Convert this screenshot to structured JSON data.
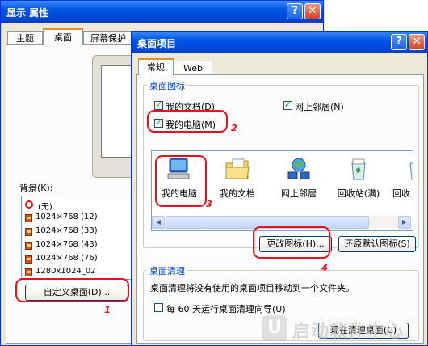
{
  "display_window": {
    "title": "显示 属性",
    "tabs": [
      "主题",
      "桌面",
      "屏幕保护"
    ],
    "background_label": "背景(K):",
    "background_items": [
      "(无)",
      "1024×768  (12)",
      "1024×768  (33)",
      "1024×768  (43)",
      "1024×768  (76)",
      "1280x1024_02"
    ],
    "customize_button": "自定义桌面(D)...",
    "help_btn": "?",
    "close_btn": "✕"
  },
  "desktop_items_window": {
    "title": "桌面项目",
    "help_btn": "?",
    "close_btn": "✕",
    "tabs": [
      "常规",
      "Web"
    ],
    "desktop_icons_group": "桌面图标",
    "checkboxes": [
      {
        "label": "我的文档(D)",
        "checked": true
      },
      {
        "label": "网上邻居(N)",
        "checked": true
      },
      {
        "label": "我的电脑(M)",
        "checked": true
      }
    ],
    "icons": [
      {
        "label": "我的电脑",
        "icon": "my-computer-icon"
      },
      {
        "label": "我的文档",
        "icon": "my-documents-icon"
      },
      {
        "label": "网上邻居",
        "icon": "network-places-icon"
      },
      {
        "label": "回收站(满)",
        "icon": "recycle-bin-full-icon"
      },
      {
        "label": "回收",
        "icon": "recycle-bin-empty-icon"
      }
    ],
    "change_icon_button": "更改图标(H)...",
    "restore_default_button": "还原默认图标(S)",
    "cleanup_group": "桌面清理",
    "cleanup_text": "桌面清理将没有使用的桌面项目移动到一个文件夹。",
    "cleanup_checkbox": {
      "label": "每 60 天运行桌面清理向导(U)",
      "checked": false
    },
    "cleanup_now_button": "现在清理桌面(C)"
  },
  "annotations": [
    "1",
    "2",
    "3",
    "4"
  ],
  "watermark": {
    "text": "启动软件中心"
  },
  "colors": {
    "annotation": "#e8101c",
    "title_bar": "#0055e5",
    "dialog_bg": "#ece9d8"
  }
}
